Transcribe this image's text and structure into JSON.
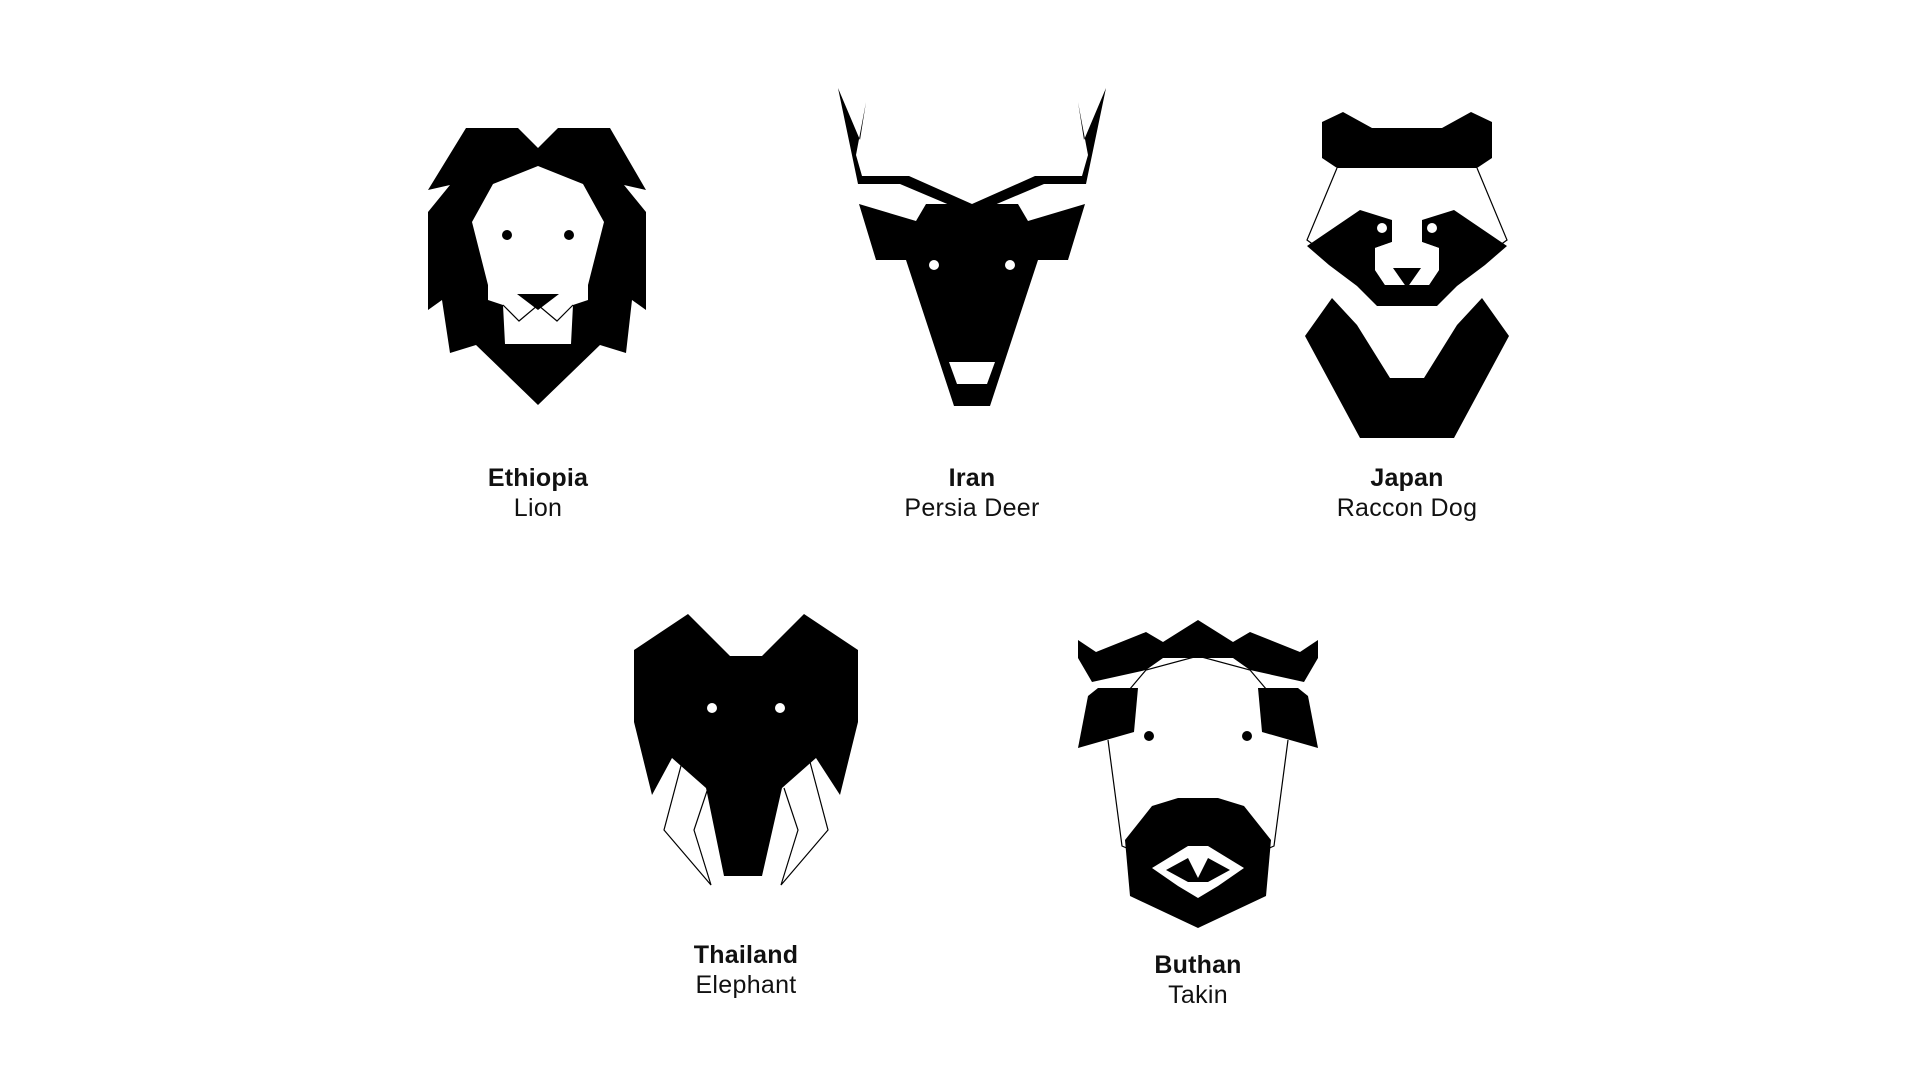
{
  "colors": {
    "background": "#ffffff",
    "ink": "#000000",
    "text": "#111111"
  },
  "items": [
    {
      "country": "Ethiopia",
      "animal": "Lion",
      "icon": "lion-icon"
    },
    {
      "country": "Iran",
      "animal": "Persia Deer",
      "icon": "deer-icon"
    },
    {
      "country": "Japan",
      "animal": "Raccon Dog",
      "icon": "raccoon-dog-icon"
    },
    {
      "country": "Thailand",
      "animal": "Elephant",
      "icon": "elephant-icon"
    },
    {
      "country": "Buthan",
      "animal": "Takin",
      "icon": "takin-icon"
    }
  ]
}
